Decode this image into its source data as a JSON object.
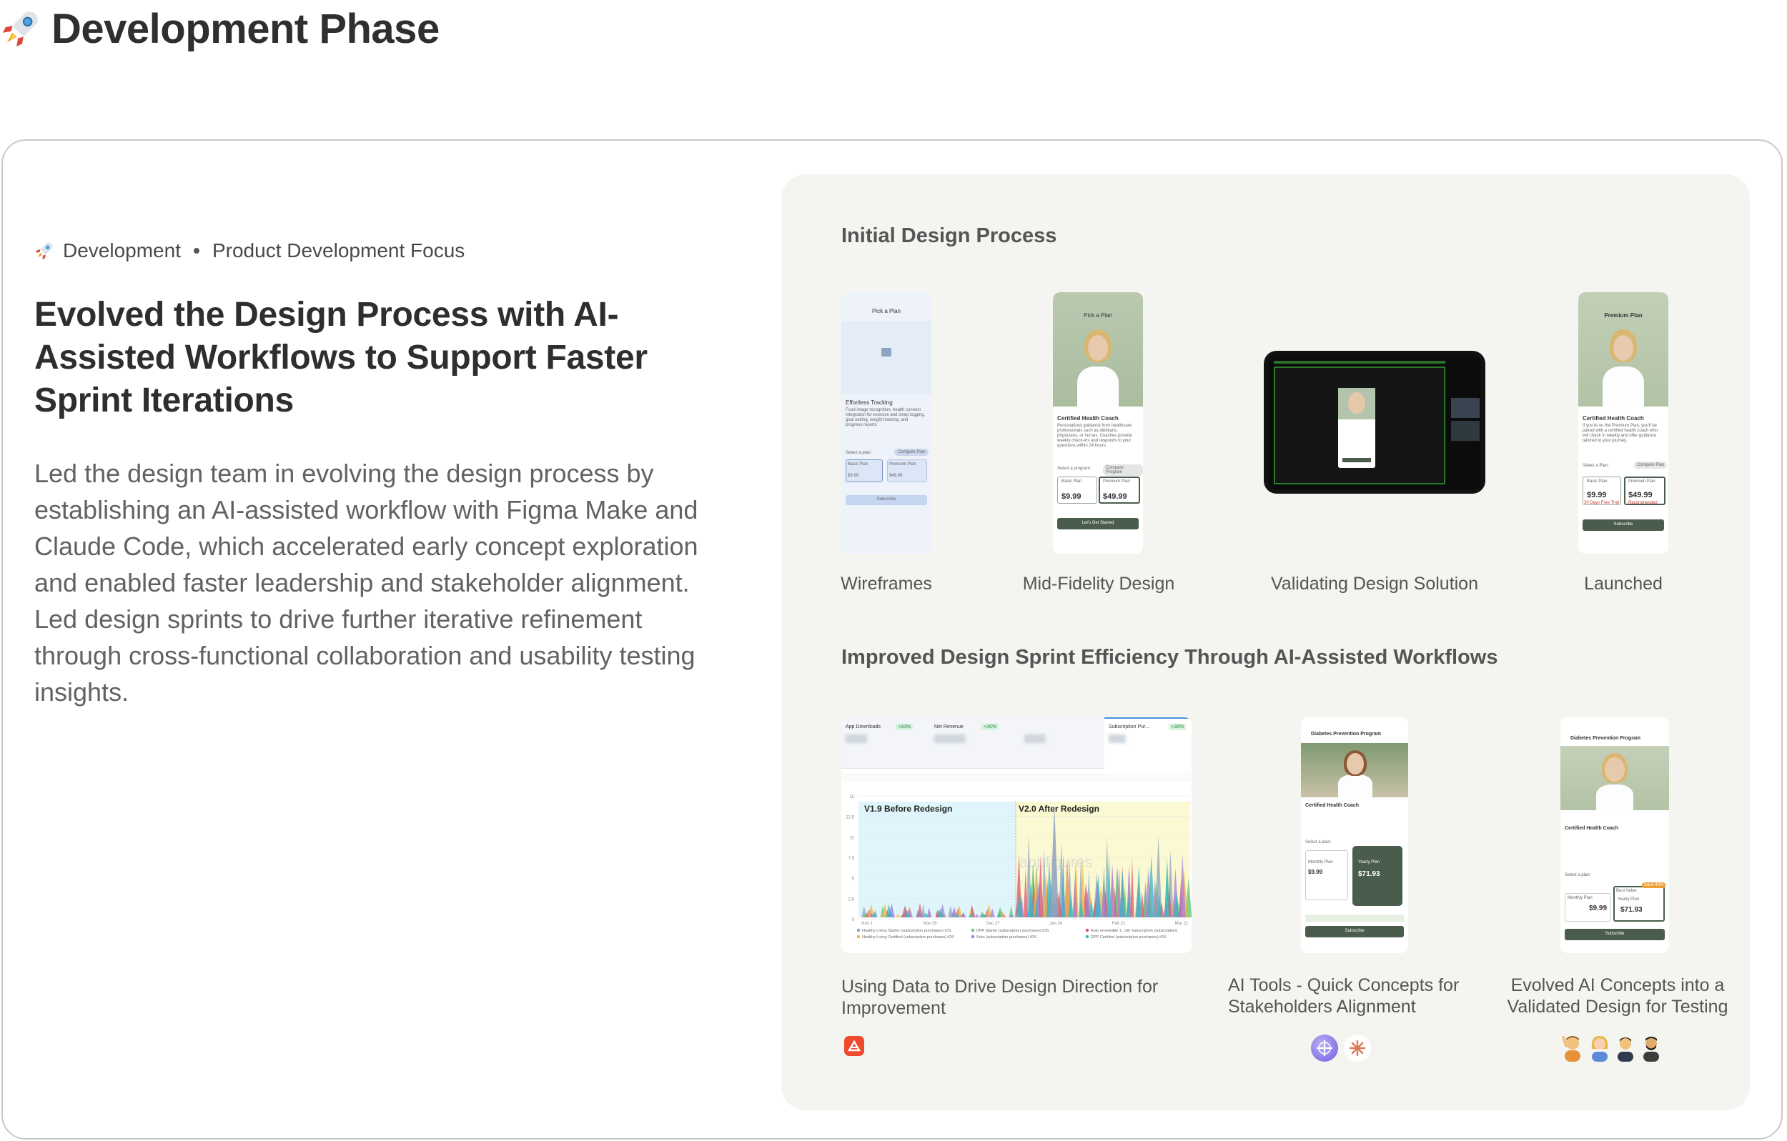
{
  "header": {
    "title": "Development Phase",
    "icon": "rocket-icon"
  },
  "left": {
    "crumb_primary": "Development",
    "crumb_secondary": "Product Development Focus",
    "headline": "Evolved the Design Process with AI-Assisted Workflows to Support Faster Sprint Iterations",
    "body": "Led the design team in evolving the design process by establishing an AI-assisted workflow with Figma Make and Claude Code, which accelerated early concept exploration and enabled faster leadership and stakeholder alignment. Led design sprints to drive further iterative refinement through cross-functional collaboration and usability testing insights."
  },
  "panel": {
    "section1_title": "Initial Design Process",
    "section2_title": "Improved Design Sprint Efficiency Through AI-Assisted Workflows",
    "captions": {
      "wireframes": "Wireframes",
      "midfi": "Mid-Fidelity Design",
      "validating": "Validating Design Solution",
      "launched": "Launched",
      "data": "Using Data to Drive Design Direction for Improvement",
      "ai_tools": "AI Tools - Quick Concepts for Stakeholders Alignment",
      "evolved": "Evolved AI Concepts into a Validated Design for Testing"
    },
    "wireframe": {
      "title": "Pick a Plan",
      "feature": "Effortless Tracking",
      "feature_desc": "Food image recognition, health connect integration for exercise and sleep logging, goal setting, weight tracking, and progress reports",
      "select": "Select a plan:",
      "compare": "Compare Plan",
      "basic": "Basic Plan",
      "basic_price": "$9.99",
      "premium": "Premium Plan",
      "premium_price": "$49.99",
      "cta": "Subscribe"
    },
    "midfi": {
      "title": "Pick a Plan",
      "coach": "Certified Health Coach",
      "coach_desc": "Personalized guidance from healthcare professionals such as dietitians, physicians, or nurses. Coaches provide weekly check-ins and responds to your questions within 24 hours.",
      "select": "Select a program:",
      "compare": "Compare Program",
      "basic": "Basic Plan",
      "basic_price": "$9.99",
      "premium": "Premium Plan",
      "premium_price": "$49.99",
      "cta": "Let's Get Started"
    },
    "launched": {
      "title": "Premium Plan",
      "coach": "Certified Health Coach",
      "coach_desc": "If you're on the Premium Plan, you'll be paired with a certified health coach who will check in weekly and offer guidance tailored to your journey.",
      "select": "Select a Plan:",
      "compare": "Compare Plan",
      "basic": "Basic Plan",
      "basic_price": "$9.99",
      "premium": "Premium Plan",
      "premium_price": "$49.99",
      "trial": "30 Days Free Trial",
      "recommended": "Recommended",
      "cta": "Subscribe"
    },
    "analytics": {
      "metrics": [
        {
          "label": "App Downloads",
          "badge": "+93%"
        },
        {
          "label": "Net Revenue",
          "badge": "+36%"
        },
        {
          "label": "Subscription Pur...",
          "badge": "+38%"
        }
      ],
      "v1_label": "V1.9 Before Redesign",
      "v2_label": "V2.0 After Redesign",
      "watermark": "appfigures",
      "y_ticks": [
        "15",
        "12.5",
        "10",
        "7.5",
        "5",
        "2.5",
        "0"
      ],
      "x_ticks": [
        "Nov 1",
        "Nov 29",
        "Dec 27",
        "Jan 24",
        "Feb 21",
        "Mar 21"
      ],
      "legend": [
        "Healthy Living Starter (subscription purchases) iOS",
        "DPP Starter (subscription purchases) iOS",
        "Auto renewable 1...nth Subscription (subscription)",
        "Healthy Living Certified (subscription purchases) iOS",
        "Nutu (subscription purchases) iOS",
        "DPP Certified (subscription purchases) iOS"
      ],
      "series_colors": [
        "#8ea0bf",
        "#5cc46f",
        "#e0526e",
        "#f0b54a",
        "#a77bd8",
        "#35b7c6"
      ]
    },
    "ai_tools_screen": {
      "title": "Diabetes Prevention Program",
      "coach": "Certified Health Coach",
      "select": "Select a plan:",
      "monthly": "Monthly Plan",
      "monthly_price": "$9.99",
      "yearly": "Yearly Plan",
      "yearly_price": "$71.93",
      "cta": "Subscribe"
    },
    "evolved_screen": {
      "title": "Diabetes Prevention Program",
      "coach": "Certified Health Coach",
      "select": "Select a plan:",
      "monthly": "Monthly Plan",
      "monthly_price": "$9.99",
      "yearly": "Yearly Plan",
      "yearly_price": "$71.93",
      "best_value": "Best Value",
      "save": "Save 40%",
      "cta": "Subscribe"
    },
    "tool_icons": [
      "appfigures-icon",
      "figma-make-icon",
      "claude-icon"
    ],
    "avatars": [
      "person-waving-avatar",
      "woman-avatar",
      "man-avatar",
      "man-beard-avatar"
    ]
  }
}
